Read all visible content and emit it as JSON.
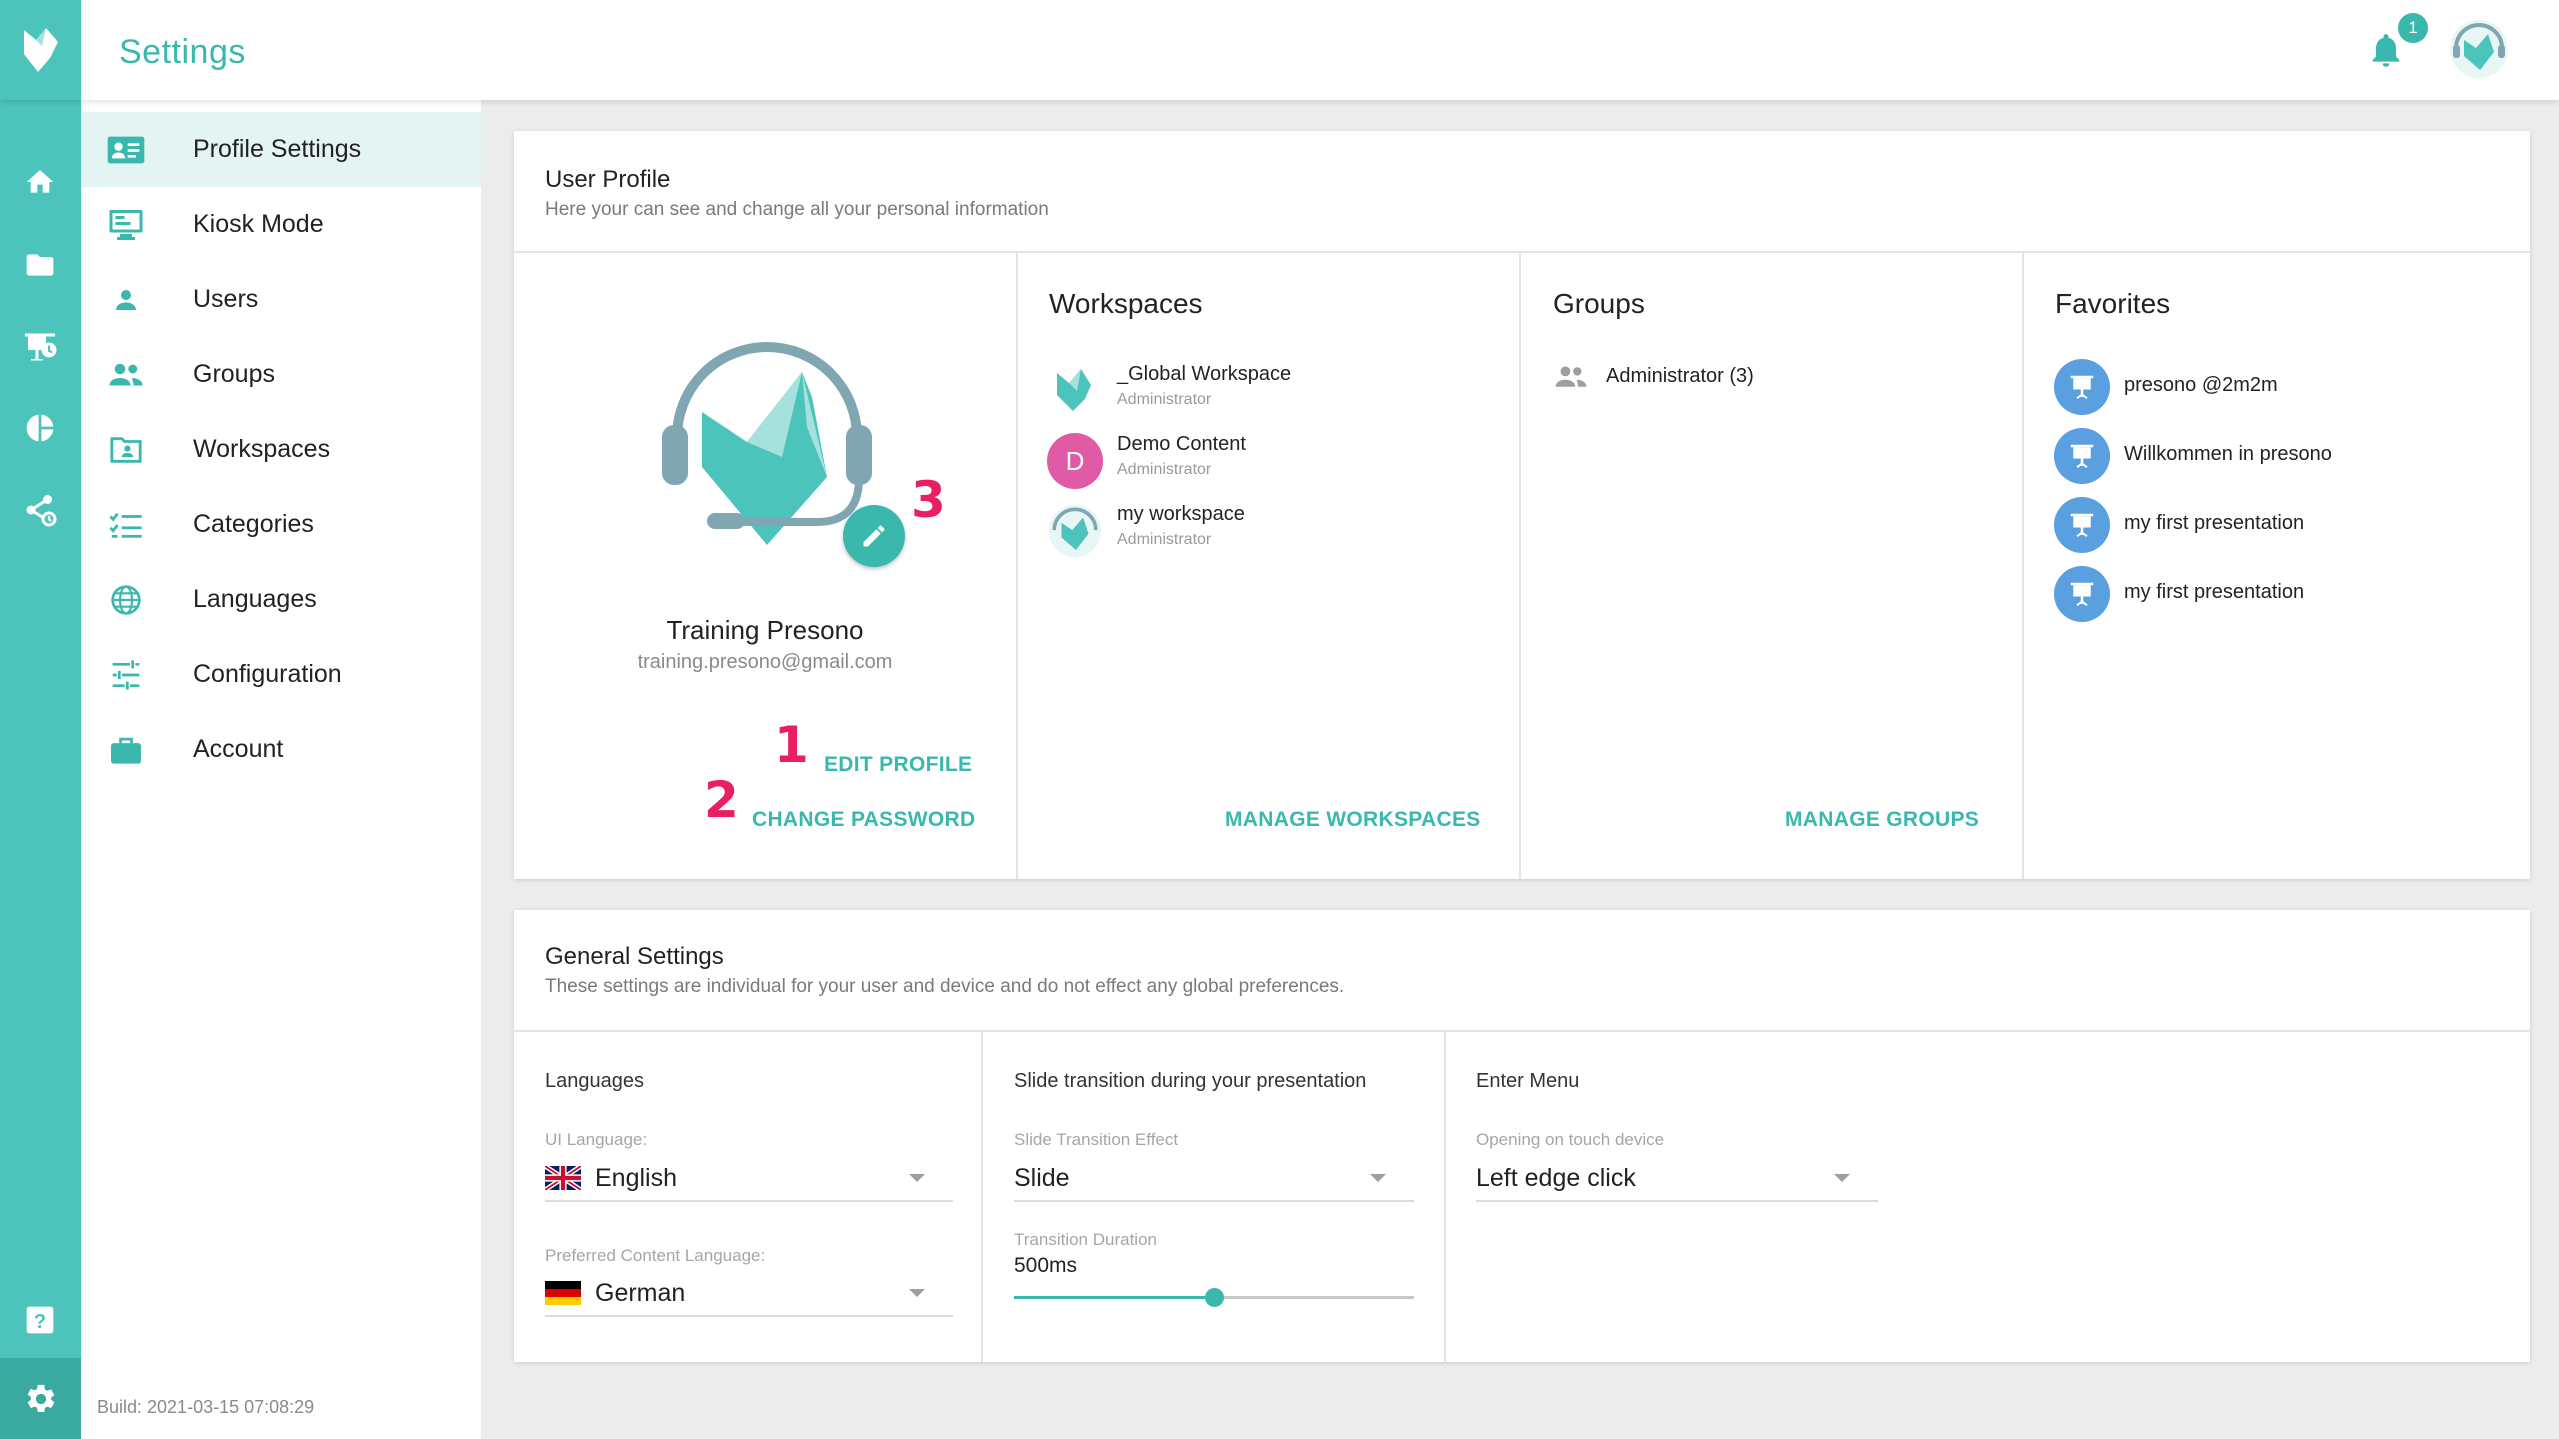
{
  "header": {
    "title": "Settings",
    "notification_count": "1",
    "accent": "#4cc4bb"
  },
  "rail": {
    "icons": [
      "home-icon",
      "folder-icon",
      "presentation-schedule-icon",
      "pie-chart-icon",
      "share-icon",
      "help-icon",
      "gear-icon"
    ]
  },
  "nav": {
    "items": [
      {
        "label": "Profile Settings",
        "icon": "id-card-icon"
      },
      {
        "label": "Kiosk Mode",
        "icon": "monitor-icon"
      },
      {
        "label": "Users",
        "icon": "person-icon"
      },
      {
        "label": "Groups",
        "icon": "people-icon"
      },
      {
        "label": "Workspaces",
        "icon": "folder-account-icon"
      },
      {
        "label": "Categories",
        "icon": "checklist-icon"
      },
      {
        "label": "Languages",
        "icon": "globe-icon"
      },
      {
        "label": "Configuration",
        "icon": "sliders-icon"
      },
      {
        "label": "Account",
        "icon": "briefcase-icon"
      }
    ],
    "build": "Build: 2021-03-15 07:08:29"
  },
  "profile_card": {
    "title": "User Profile",
    "subtitle": "Here your can see and change all your personal information",
    "user_name": "Training Presono",
    "user_email": "training.presono@gmail.com",
    "edit_profile": "EDIT PROFILE",
    "change_password": "CHANGE PASSWORD",
    "markers": [
      "1",
      "2",
      "3"
    ],
    "workspaces": {
      "title": "Workspaces",
      "items": [
        {
          "name": "_Global Workspace",
          "role": "Administrator"
        },
        {
          "name": "Demo Content",
          "role": "Administrator",
          "initial": "D"
        },
        {
          "name": "my workspace",
          "role": "Administrator"
        }
      ],
      "manage": "MANAGE WORKSPACES"
    },
    "groups": {
      "title": "Groups",
      "items": [
        {
          "name": "Administrator (3)"
        }
      ],
      "manage": "MANAGE GROUPS"
    },
    "favorites": {
      "title": "Favorites",
      "items": [
        {
          "name": "presono @2m2m"
        },
        {
          "name": "Willkommen in presono"
        },
        {
          "name": "my first presentation"
        },
        {
          "name": "my first presentation"
        }
      ]
    }
  },
  "general_card": {
    "title": "General Settings",
    "subtitle": "These settings are individual for your user and device and do not effect any global preferences.",
    "languages": {
      "title": "Languages",
      "ui_label": "UI Language:",
      "ui_value": "English",
      "content_label": "Preferred Content Language:",
      "content_value": "German"
    },
    "transition": {
      "title": "Slide transition during your presentation",
      "effect_label": "Slide Transition Effect",
      "effect_value": "Slide",
      "duration_label": "Transition Duration",
      "duration_value": "500ms",
      "slider_fraction": 0.5
    },
    "enter_menu": {
      "title": "Enter Menu",
      "label": "Opening on touch device",
      "value": "Left edge click"
    }
  }
}
